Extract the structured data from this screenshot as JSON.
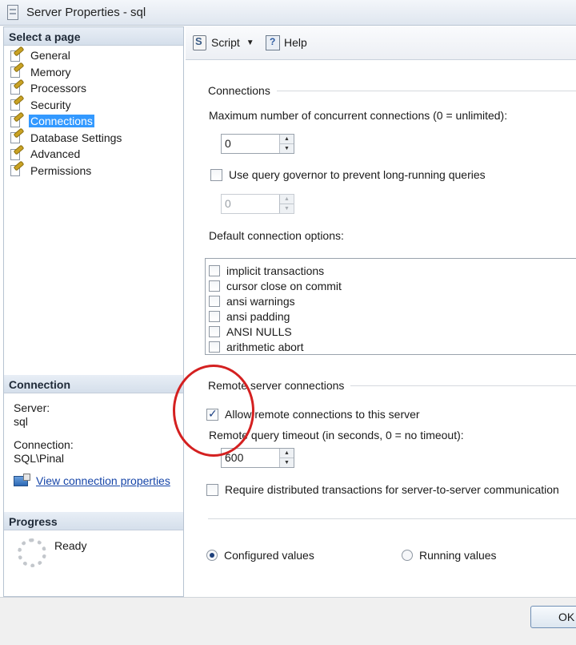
{
  "window": {
    "title": "Server Properties - sql"
  },
  "left": {
    "select_page_header": "Select a page",
    "pages": [
      {
        "label": "General"
      },
      {
        "label": "Memory"
      },
      {
        "label": "Processors"
      },
      {
        "label": "Security"
      },
      {
        "label": "Connections",
        "selected": true
      },
      {
        "label": "Database Settings"
      },
      {
        "label": "Advanced"
      },
      {
        "label": "Permissions"
      }
    ],
    "connection": {
      "header": "Connection",
      "server_label": "Server:",
      "server_value": "sql",
      "connection_label": "Connection:",
      "connection_value": "SQL\\Pinal",
      "view_link": "View connection properties"
    },
    "progress": {
      "header": "Progress",
      "status": "Ready"
    }
  },
  "toolbar": {
    "script_label": "Script",
    "help_label": "Help"
  },
  "main": {
    "connections_group": "Connections",
    "max_conn_label": "Maximum number of concurrent connections (0 = unlimited):",
    "max_conn_value": "0",
    "query_governor": {
      "label": "Use query governor to prevent long-running queries",
      "checked": false
    },
    "governor_value": "0",
    "default_options_label": "Default connection options:",
    "default_options": [
      {
        "label": "implicit transactions",
        "checked": false
      },
      {
        "label": "cursor close on commit",
        "checked": false
      },
      {
        "label": "ansi warnings",
        "checked": false
      },
      {
        "label": "ansi padding",
        "checked": false
      },
      {
        "label": "ANSI NULLS",
        "checked": false
      },
      {
        "label": "arithmetic abort",
        "checked": false
      }
    ],
    "remote_group": "Remote server connections",
    "allow_remote": {
      "label": "Allow remote connections to this server",
      "checked": true
    },
    "remote_timeout_label": "Remote query timeout (in seconds, 0 = no timeout):",
    "remote_timeout_value": "600",
    "require_distributed": {
      "label": "Require distributed transactions for server-to-server communication",
      "checked": false
    },
    "configured_values": "Configured values",
    "running_values": "Running values",
    "selected_radio": "configured"
  },
  "buttons": {
    "ok": "OK"
  },
  "colors": {
    "selection": "#3399ff",
    "annotation_circle": "#d42020",
    "link": "#1645a8"
  }
}
